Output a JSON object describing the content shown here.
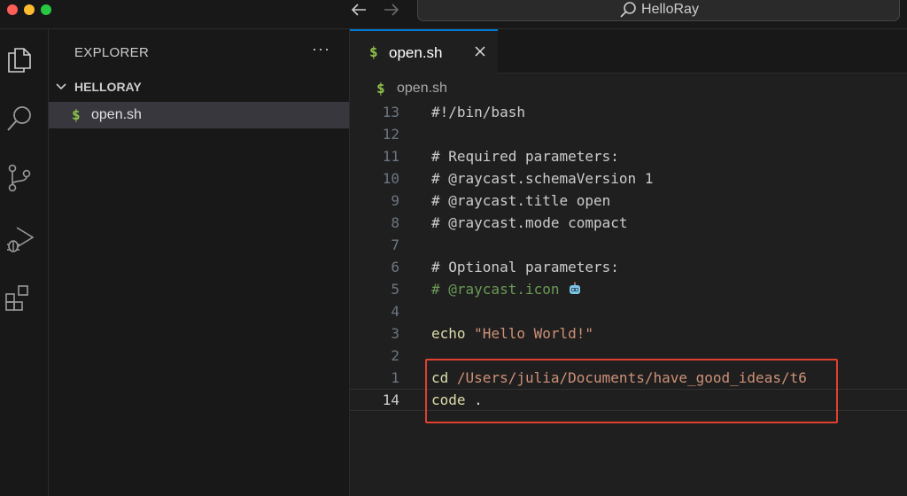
{
  "window": {
    "title": "HelloRay"
  },
  "activity_bar": {
    "icons": [
      "explorer-icon",
      "search-icon",
      "source-control-icon",
      "run-debug-icon",
      "extensions-icon"
    ]
  },
  "sidebar": {
    "title": "EXPLORER",
    "more_label": "···",
    "folder": "HELLORAY",
    "files": [
      {
        "icon": "$",
        "name": "open.sh"
      }
    ]
  },
  "tab": {
    "icon": "$",
    "label": "open.sh"
  },
  "breadcrumb": {
    "icon": "$",
    "label": "open.sh"
  },
  "editor": {
    "lines": [
      {
        "number": "13",
        "text": "#!/bin/bash"
      },
      {
        "number": "12",
        "text": ""
      },
      {
        "number": "11",
        "text": "# Required parameters:"
      },
      {
        "number": "10",
        "text": "# @raycast.schemaVersion 1"
      },
      {
        "number": "9",
        "text": "# @raycast.title open"
      },
      {
        "number": "8",
        "text": "# @raycast.mode compact"
      },
      {
        "number": "7",
        "text": ""
      },
      {
        "number": "6",
        "text": "# Optional parameters:"
      },
      {
        "number": "5",
        "text": "# @raycast.icon"
      },
      {
        "number": "4",
        "text": ""
      },
      {
        "number": "3",
        "cmd": "echo",
        "arg": "\"Hello World!\""
      },
      {
        "number": "2",
        "text": ""
      },
      {
        "number": "1",
        "cmd": "cd",
        "arg": "/Users/julia/Documents/have_good_ideas/t6"
      },
      {
        "number": "14",
        "cmd": "code",
        "arg": "."
      }
    ]
  },
  "colors": {
    "accent": "#0078d4",
    "highlight_box": "#e0402f",
    "shell_icon": "#8dc149",
    "comment": "#6a9955",
    "string": "#ce9178"
  }
}
